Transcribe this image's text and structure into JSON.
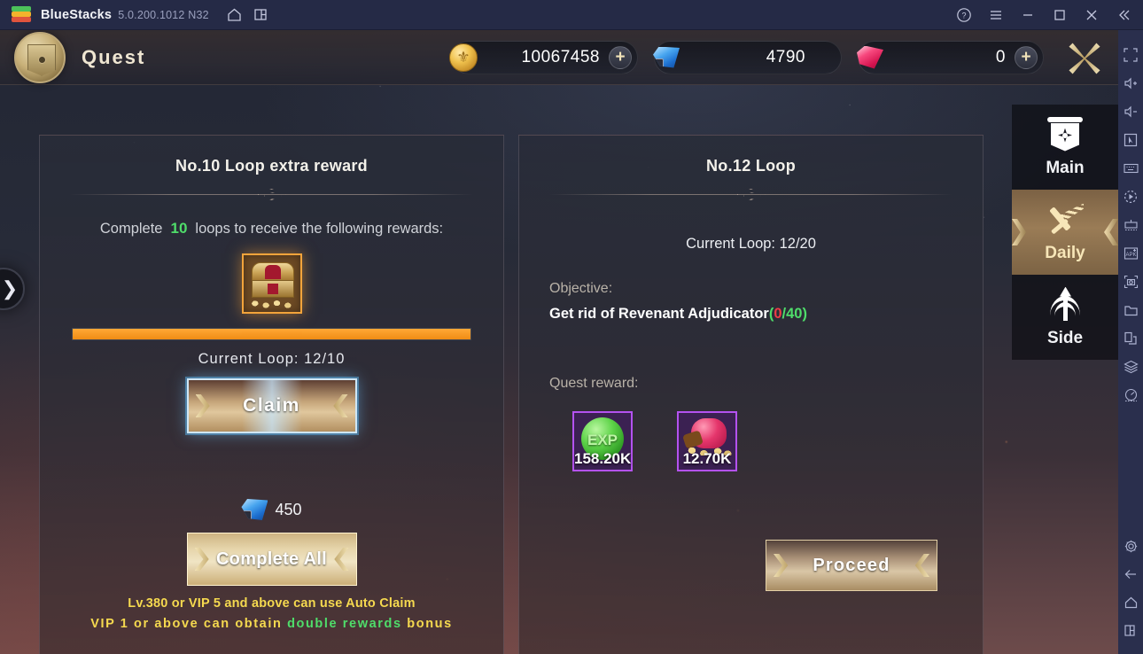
{
  "titlebar": {
    "app_name": "BlueStacks",
    "version": "5.0.200.1012 N32",
    "icons": [
      "home-icon",
      "instances-icon"
    ],
    "right_icons": [
      "help-icon",
      "menu-icon",
      "minimize-icon",
      "maximize-icon",
      "close-icon",
      "collapse-icon"
    ]
  },
  "hud": {
    "screen_title": "Quest",
    "currencies": [
      {
        "icon": "gold-coin-icon",
        "value": "10067458",
        "has_plus": true
      },
      {
        "icon": "blue-diamond-icon",
        "value": "4790",
        "has_plus": false
      },
      {
        "icon": "red-ruby-icon",
        "value": "0",
        "has_plus": true
      }
    ],
    "plus_label": "+",
    "close_button": "close-quest-button"
  },
  "left_panel": {
    "title": "No.10 Loop extra reward",
    "requirement_prefix": "Complete",
    "requirement_count": "10",
    "requirement_suffix": "loops to receive the following rewards:",
    "reward_icon": "treasure-chest-icon",
    "progress_percent": 100,
    "current_loop": "Current Loop: 12/10",
    "claim_button": "Claim",
    "bonus_gem_icon": "blue-diamond-icon",
    "bonus_gem_amount": "450",
    "complete_all_button": "Complete All",
    "note_line1": "Lv.380 or VIP 5 and above can use Auto Claim",
    "note_line2_part1": "VIP 1 or above can obtain",
    "note_line2_highlight": "double rewards",
    "note_line2_part2": "bonus"
  },
  "right_panel": {
    "title": "No.12 Loop",
    "current_loop": "Current Loop: 12/20",
    "objective_label": "Objective:",
    "objective_text": "Get rid of Revenant Adjudicator",
    "objective_open_paren": "(",
    "objective_current": "0",
    "objective_slash": "/",
    "objective_target": "40",
    "objective_close_paren": ")",
    "quest_reward_label": "Quest reward:",
    "rewards": [
      {
        "icon": "exp-orb-icon",
        "amount": "158.20K"
      },
      {
        "icon": "coin-pouch-icon",
        "amount": "12.70K"
      }
    ],
    "proceed_button": "Proceed"
  },
  "tabs": [
    {
      "label": "Main",
      "icon": "banner-icon",
      "active": false
    },
    {
      "label": "Daily",
      "icon": "winged-sword-icon",
      "active": true
    },
    {
      "label": "Side",
      "icon": "tree-arrow-icon",
      "active": false
    }
  ],
  "edge_expand": "❯",
  "sidebar_icons_top": [
    "fullscreen-icon",
    "volume-up-icon",
    "volume-down-icon",
    "pointer-icon",
    "keyboard-icon",
    "macro-record-icon",
    "keymapping-icon",
    "install-apk-icon",
    "screenshot-icon",
    "media-folder-icon",
    "multi-instance-clone-icon"
  ],
  "sidebar_icons_mid": [
    "instance-manager-icon",
    "performance-meter-icon"
  ],
  "sidebar_icons_bottom": [
    "settings-gear-icon",
    "back-icon",
    "home-icon",
    "recents-icon"
  ],
  "colors": {
    "accent_orange": "#ef8c14",
    "green": "#4fdd6a",
    "red": "#ef3c46",
    "yellow_note": "#f5d94f",
    "purple_border": "#b452f0",
    "gold": "#f7e6b8"
  }
}
